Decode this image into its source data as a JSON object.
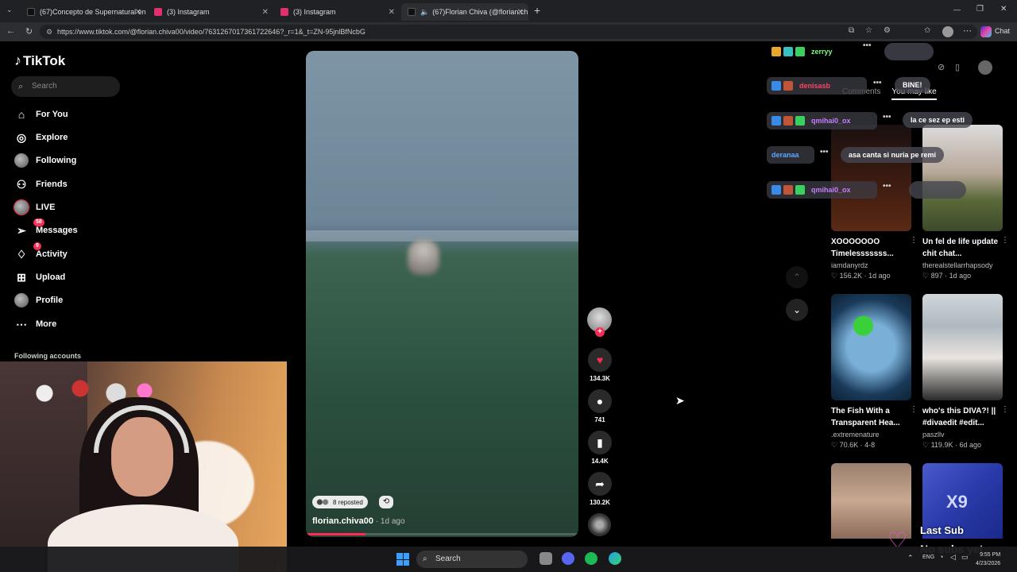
{
  "browser": {
    "tabs": [
      {
        "title": "(67)Concepto de Supernatural en",
        "favicon_color": "#111111"
      },
      {
        "title": "(3) Instagram",
        "favicon_color": "#e1306c"
      },
      {
        "title": "(3) Instagram",
        "favicon_color": "#e1306c"
      },
      {
        "title": "(67)Florian Chiva (@florian.ch",
        "favicon_color": "#111111"
      }
    ],
    "new_tab_icon": "+",
    "url": "https://www.tiktok.com/@florian.chiva00/video/7631267017361722646?_r=1&_t=ZN-95jnlBfNcbG",
    "chat_label": "Chat"
  },
  "sidebar": {
    "logo": "TikTok",
    "search_placeholder": "Search",
    "nav": [
      {
        "label": "For You",
        "icon": "home-icon"
      },
      {
        "label": "Explore",
        "icon": "compass-icon"
      },
      {
        "label": "Following",
        "icon": "avatar"
      },
      {
        "label": "Friends",
        "icon": "friends-icon"
      },
      {
        "label": "LIVE",
        "icon": "avatar"
      },
      {
        "label": "Messages",
        "icon": "send-icon",
        "badge": "58"
      },
      {
        "label": "Activity",
        "icon": "bell-icon",
        "badge": "9"
      },
      {
        "label": "Upload",
        "icon": "plus-square-icon"
      },
      {
        "label": "Profile",
        "icon": "avatar"
      },
      {
        "label": "More",
        "icon": "more-icon"
      }
    ],
    "following_title": "Following accounts"
  },
  "video": {
    "reposted": "8 reposted",
    "author": "florian.chiva00",
    "time": " · 1d ago",
    "progress": 0.22,
    "likes": "134.3K",
    "comments": "741",
    "saves": "14.4K",
    "shares": "130.2K"
  },
  "panel": {
    "tab_comments": "Comments",
    "tab_you_may_like": "You may like",
    "cards": [
      {
        "title": "⁠XOOOOOOO Timelesssssss...",
        "user": "iamdanyrdz",
        "likes": "156.2K",
        "date": "1d ago"
      },
      {
        "title": "Un fel de life update chit chat...",
        "user": "therealstellarrhapsody",
        "likes": "897",
        "date": "1d ago"
      },
      {
        "title": "The Fish With a Transparent Hea...",
        "user": ".extremenature",
        "likes": "70.6K",
        "date": "4-8"
      },
      {
        "title": "who's this DIVA?! || #divaedit #edit...",
        "user": "paszllv",
        "likes": "119.9K",
        "date": "6d ago"
      }
    ],
    "thumb5_text": "X9"
  },
  "chat": {
    "rows": [
      {
        "user": "zerryy",
        "color": "#7cfc7c"
      },
      {
        "user": "denisasb",
        "color": "#ff4466"
      },
      {
        "user": "qmihai0_ox",
        "color": "#c77dff"
      },
      {
        "user": "deranaa",
        "color": "#5aa9ff"
      },
      {
        "user": "qmihai0_ox",
        "color": "#c77dff"
      }
    ],
    "bubbles": [
      "BINE!",
      "la ce sez ep esti",
      "asa canta si nuria pe remi"
    ],
    "last_sub_label": "Last Sub",
    "no_subs_label": "No subs yet"
  },
  "taskbar": {
    "search_label": "Search",
    "lang": "ENG",
    "time": "9:55 PM",
    "date": "4/23/2026"
  }
}
